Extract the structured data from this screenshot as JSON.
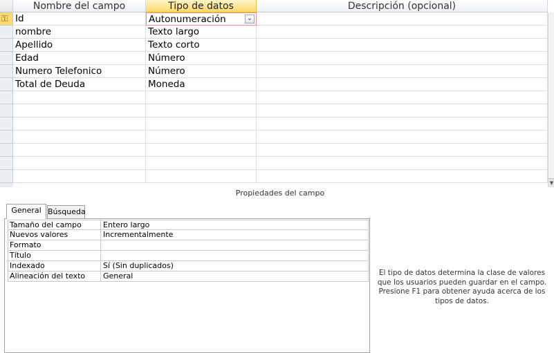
{
  "grid": {
    "headers": {
      "name": "Nombre del campo",
      "type": "Tipo de datos",
      "desc": "Descripción (opcional)"
    },
    "rows": [
      {
        "name": "Id",
        "type": "Autonumeración",
        "desc": ""
      },
      {
        "name": "nombre",
        "type": "Texto largo",
        "desc": ""
      },
      {
        "name": "Apellido",
        "type": "Texto corto",
        "desc": ""
      },
      {
        "name": "Edad",
        "type": "Número",
        "desc": ""
      },
      {
        "name": "Numero Telefonico",
        "type": "Número",
        "desc": ""
      },
      {
        "name": "Total de Deuda",
        "type": "Moneda",
        "desc": ""
      },
      {
        "name": "",
        "type": "",
        "desc": ""
      },
      {
        "name": "",
        "type": "",
        "desc": ""
      },
      {
        "name": "",
        "type": "",
        "desc": ""
      },
      {
        "name": "",
        "type": "",
        "desc": ""
      },
      {
        "name": "",
        "type": "",
        "desc": ""
      },
      {
        "name": "",
        "type": "",
        "desc": ""
      },
      {
        "name": "",
        "type": "",
        "desc": ""
      }
    ],
    "primary_key_icon": "key-icon",
    "dropdown_icon": "chevron-down-icon"
  },
  "properties": {
    "title": "Propiedades del campo",
    "tabs": {
      "general": "General",
      "lookup": "Búsqueda"
    },
    "rows": [
      {
        "label": "Tamaño del campo",
        "value": "Entero largo"
      },
      {
        "label": "Nuevos valores",
        "value": "Incrementalmente"
      },
      {
        "label": "Formato",
        "value": ""
      },
      {
        "label": "Título",
        "value": ""
      },
      {
        "label": "Indexado",
        "value": "Sí (Sin duplicados)"
      },
      {
        "label": "Alineación del texto",
        "value": "General"
      }
    ],
    "help_text": "El tipo de datos determina la clase de valores que los usuarios pueden guardar en el campo. Presione F1 para obtener ayuda acerca de los tipos de datos."
  },
  "colors": {
    "active_header": "#ffd86a",
    "active_row_selector": "#fcd873",
    "active_cell_border": "#e88d95"
  }
}
